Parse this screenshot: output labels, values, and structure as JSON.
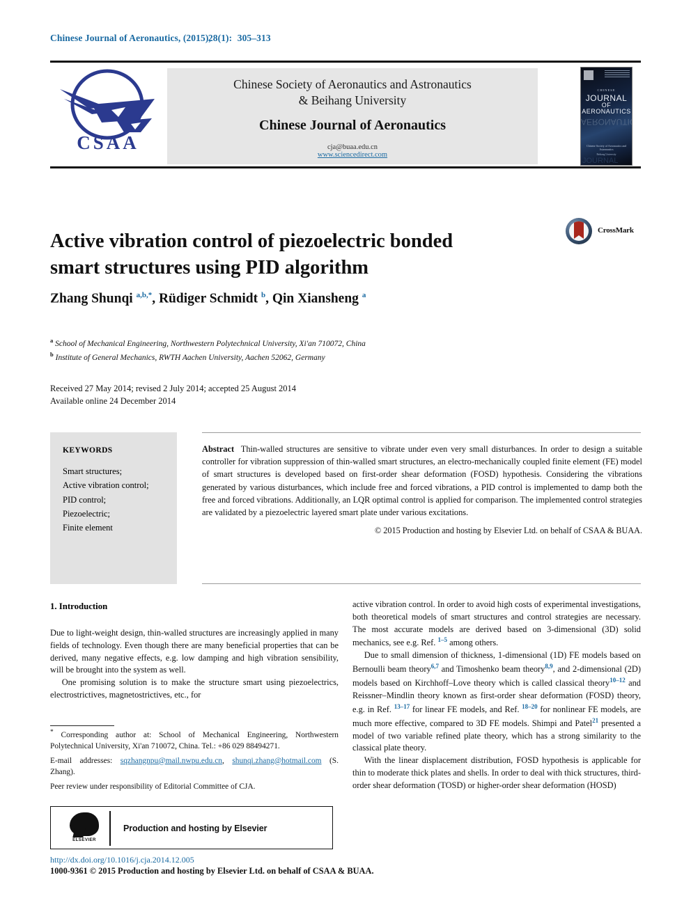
{
  "running_head": {
    "journal": "Chinese Journal of Aeronautics, (2015),",
    "volume_issue": "28(1):",
    "pages": "305–313",
    "color": "#1a6aa2"
  },
  "masthead": {
    "society_line1": "Chinese Society of Aeronautics and Astronautics",
    "society_line2": "& Beihang University",
    "journal_title": "Chinese Journal of Aeronautics",
    "email": "cja@buaa.edu.cn",
    "url": "www.sciencedirect.com",
    "logo_text": "CSAA",
    "logo_name": "csaa-logo",
    "cover": {
      "kicker": "CHINESE",
      "line1": "JOURNAL",
      "line2": "OF",
      "line3": "AERONAUTICS",
      "footer1": "Chinese Society of Aeronautics and Astronautics",
      "footer2": "Beihang University"
    }
  },
  "article": {
    "title": "Active vibration control of piezoelectric bonded smart structures using PID algorithm",
    "crossmark_label": "CrossMark",
    "authors_html": "Zhang Shunqi <sup>a,b,</sup><sup>*</sup>, R&uuml;diger Schmidt <sup>b</sup>, Qin Xiansheng <sup>a</sup>",
    "affiliations": [
      {
        "marker": "a",
        "text": "School of Mechanical Engineering, Northwestern Polytechnical University, Xi'an 710072, China"
      },
      {
        "marker": "b",
        "text": "Institute of General Mechanics, RWTH Aachen University, Aachen 52062, Germany"
      }
    ],
    "dates_line1": "Received 27 May 2014; revised 2 July 2014; accepted 25 August 2014",
    "dates_line2": "Available online 24 December 2014"
  },
  "keywords": {
    "heading": "KEYWORDS",
    "items": [
      "Smart structures;",
      "Active vibration control;",
      "PID control;",
      "Piezoelectric;",
      "Finite element"
    ]
  },
  "abstract": {
    "label": "Abstract",
    "text": "Thin-walled structures are sensitive to vibrate under even very small disturbances. In order to design a suitable controller for vibration suppression of thin-walled smart structures, an electro-mechanically coupled finite element (FE) model of smart structures is developed based on first-order shear deformation (FOSD) hypothesis. Considering the vibrations generated by various disturbances, which include free and forced vibrations, a PID control is implemented to damp both the free and forced vibrations. Additionally, an LQR optimal control is applied for comparison. The implemented control strategies are validated by a piezoelectric layered smart plate under various excitations.",
    "copyright": "© 2015 Production and hosting by Elsevier Ltd. on behalf of CSAA & BUAA."
  },
  "introduction": {
    "heading": "1. Introduction",
    "left_paragraph_1": "Due to light-weight design, thin-walled structures are increasingly applied in many fields of technology. Even though there are many beneficial properties that can be derived, many negative effects, e.g. low damping and high vibration sensibility, will be brought into the system as well.",
    "left_paragraph_2": "One promising solution is to make the structure smart using piezoelectrics, electrostrictives, magnetostrictives, etc., for",
    "right_paragraph_1_html": "active vibration control. In order to avoid high costs of experimental investigations, both theoretical models of smart structures and control strategies are necessary. The most accurate models are derived based on 3-dimensional (3D) solid mechanics, see e.g. Ref. <sup class=\"ref\">1–5</sup> among others.",
    "right_paragraph_2_html": "Due to small dimension of thickness, 1-dimensional (1D) FE models based on Bernoulli beam theory<sup class=\"ref\">6,7</sup> and Timoshenko beam theory<sup class=\"ref\">8,9</sup>, and 2-dimensional (2D) models based on Kirchhoff–Love theory which is called classical theory<sup class=\"ref\">10–12</sup> and Reissner–Mindlin theory known as first-order shear deformation (FOSD) theory, e.g. in Ref. <sup class=\"ref\">13–17</sup> for linear FE models, and Ref. <sup class=\"ref\">18–20</sup> for nonlinear FE models, are much more effective, compared to 3D FE models. Shimpi and Patel<sup class=\"ref\">21</sup> presented a model of two variable refined plate theory, which has a strong similarity to the classical plate theory.",
    "right_paragraph_3_html": "With the linear displacement distribution, FOSD hypothesis is applicable for thin to moderate thick plates and shells. In order to deal with thick structures, third-order shear deformation (TOSD) or higher-order shear deformation (HOSD)"
  },
  "footnote": {
    "corresponding_html": "<sup>*</sup> Corresponding author at: School of Mechanical Engineering, Northwestern Polytechnical University, Xi'an 710072, China. Tel.: +86 029 88494271.",
    "email_label": "E-mail addresses:",
    "email1": "sqzhangnpu@mail.nwpu.edu.cn",
    "email2": "shunqi.zhang@hotmail.com",
    "email_suffix": "(S. Zhang).",
    "peer_review": "Peer review under responsibility of Editorial Committee of CJA."
  },
  "elsevier_box": {
    "logo_word": "ELSEVIER",
    "text": "Production and hosting by Elsevier"
  },
  "bottom": {
    "doi": "http://dx.doi.org/10.1016/j.cja.2014.12.005",
    "issn_line": "1000-9361 © 2015 Production and hosting by Elsevier Ltd. on behalf of CSAA & BUAA."
  }
}
